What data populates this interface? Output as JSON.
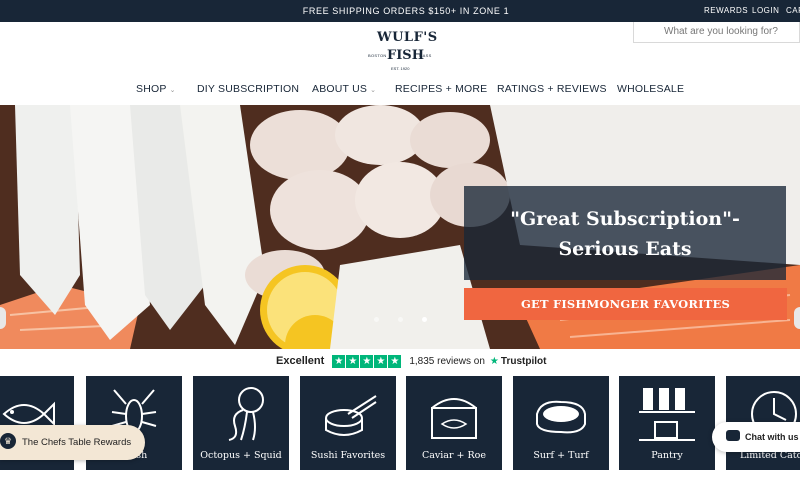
{
  "topbar": {
    "promo": "FREE SHIPPING ORDERS $150+ IN ZONE 1",
    "rewards": "REWARDS",
    "login": "LOGIN",
    "cart": "CART"
  },
  "search": {
    "placeholder": "What are you looking for?"
  },
  "logo": {
    "line1": "WULF'S",
    "line2": "FISH",
    "left": "BOSTON",
    "right": "MASS",
    "est": "EST. 1920"
  },
  "nav": [
    {
      "label": "SHOP"
    },
    {
      "label": "DIY SUBSCRIPTION"
    },
    {
      "label": "ABOUT US"
    },
    {
      "label": "RECIPES + MORE"
    },
    {
      "label": "RATINGS + REVIEWS"
    },
    {
      "label": "WHOLESALE"
    }
  ],
  "hero": {
    "quote_line1": "\"Great Subscription\"-",
    "quote_line2": "Serious Eats",
    "cta": "GET FISHMONGER FAVORITES"
  },
  "trustpilot": {
    "rating_word": "Excellent",
    "reviews": "1,835 reviews on",
    "brand": "Trustpilot"
  },
  "categories": [
    {
      "label": "",
      "icon": "fish-icon"
    },
    {
      "label": "...fish",
      "icon": "lobster-icon"
    },
    {
      "label": "Octopus + Squid",
      "icon": "octopus-icon"
    },
    {
      "label": "Sushi Favorites",
      "icon": "sushi-icon"
    },
    {
      "label": "Caviar + Roe",
      "icon": "caviar-tin-icon"
    },
    {
      "label": "Surf + Turf",
      "icon": "steak-icon"
    },
    {
      "label": "Pantry",
      "icon": "pantry-shelf-icon"
    },
    {
      "label": "Limited Catch",
      "icon": "clock-icon"
    }
  ],
  "rewards_widget": {
    "label": "The Chefs Table Rewards"
  },
  "chat_widget": {
    "label": "Chat with us"
  },
  "colors": {
    "navy": "#182637",
    "cta_orange": "#f06640",
    "trustpilot_green": "#00b67a"
  }
}
